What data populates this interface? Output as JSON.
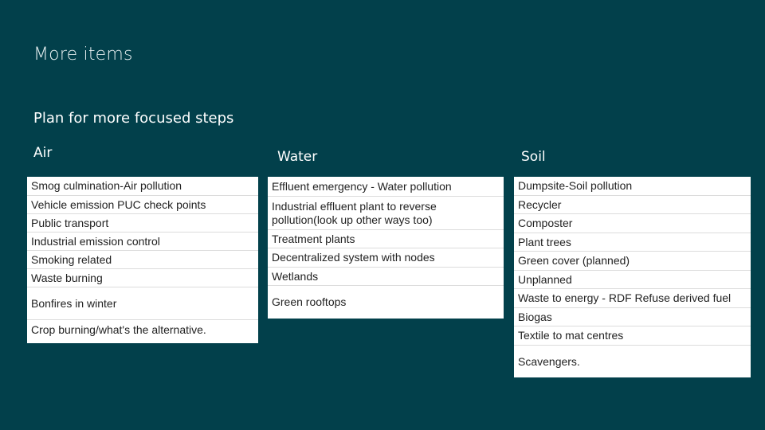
{
  "slide": {
    "title": "More items",
    "subtitle": "Plan for more focused steps"
  },
  "columns": [
    {
      "heading": "Air",
      "items": [
        "Smog culmination-Air pollution",
        "Vehicle emission PUC check points",
        "Public transport",
        "Industrial emission control",
        "Smoking related",
        "Waste burning",
        "Bonfires in winter",
        "Crop burning/what's the alternative."
      ]
    },
    {
      "heading": "Water",
      "items": [
        "Effluent emergency - Water pollution",
        "Industrial effluent plant to reverse pollution(look up other ways too)",
        "Treatment plants",
        "Decentralized system with nodes",
        "Wetlands",
        "Green rooftops"
      ]
    },
    {
      "heading": "Soil",
      "items": [
        "Dumpsite-Soil pollution",
        "Recycler",
        "Composter",
        "Plant trees",
        "Green cover (planned)",
        "Unplanned",
        "Waste to energy - RDF Refuse derived fuel",
        "Biogas",
        "Textile to mat centres",
        "Scavengers."
      ]
    }
  ]
}
